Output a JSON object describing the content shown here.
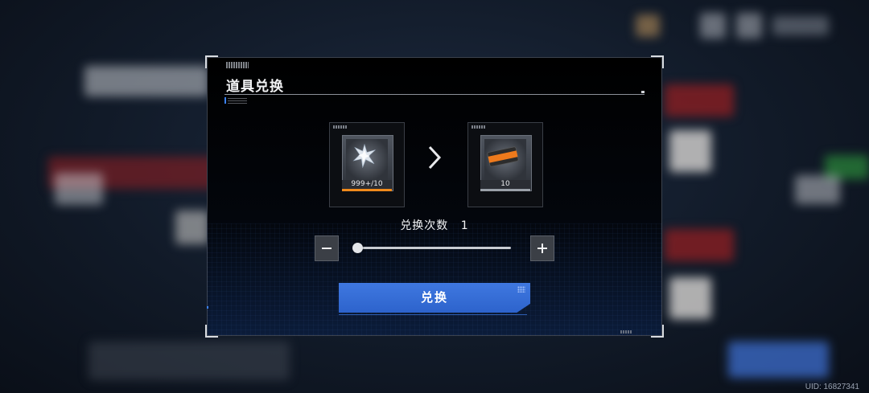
{
  "dialog": {
    "title": "道具兑换",
    "from_item": {
      "icon": "star-crystal-icon",
      "count": "999+/10"
    },
    "to_item": {
      "icon": "refresh-ticket-icon",
      "count": "10"
    },
    "count_label": "兑换次数",
    "count_value": "1",
    "slider": {
      "min": 1,
      "current": 1
    },
    "exchange_label": "兑换"
  },
  "footer": {
    "uid": "UID: 16827341"
  },
  "colors": {
    "accent_blue": "#2d63cc",
    "rarity_orange": "#f08a1c",
    "rarity_gray": "#9aa0a8"
  }
}
